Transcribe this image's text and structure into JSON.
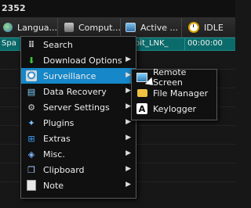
{
  "title": "2352",
  "header": {
    "columns": [
      {
        "label": "Langua...",
        "icon": "globe-icon"
      },
      {
        "label": "Comput...",
        "icon": "computer-icon"
      },
      {
        "label": "Active ...",
        "icon": "monitor-icon"
      },
      {
        "label": "IDLE",
        "icon": "clock-icon"
      }
    ]
  },
  "selected_row": {
    "c1": "Spa",
    "c2": "ploit_LNK_",
    "c3": "00:00:00"
  },
  "context_menu": {
    "items": [
      {
        "label": "Search",
        "icon": "search-icon",
        "submenu": false
      },
      {
        "label": "Download Options",
        "icon": "download-icon",
        "submenu": true
      },
      {
        "label": "Surveillance",
        "icon": "surveillance-icon",
        "submenu": true,
        "highlighted": true
      },
      {
        "label": "Data Recovery",
        "icon": "data-recovery-icon",
        "submenu": true
      },
      {
        "label": "Server Settings",
        "icon": "gear-icon",
        "submenu": true
      },
      {
        "label": "Plugins",
        "icon": "plugins-icon",
        "submenu": true
      },
      {
        "label": "Extras",
        "icon": "extras-icon",
        "submenu": true
      },
      {
        "label": "Misc.",
        "icon": "misc-icon",
        "submenu": true
      },
      {
        "label": "Clipboard",
        "icon": "clipboard-icon",
        "submenu": true
      },
      {
        "label": "Note",
        "icon": "note-icon",
        "submenu": true
      }
    ]
  },
  "submenu": {
    "items": [
      {
        "label": "Remote Screen",
        "icon": "remote-screen-icon"
      },
      {
        "label": "File Manager",
        "icon": "folder-icon"
      },
      {
        "label": "Keylogger",
        "icon": "keylogger-icon"
      }
    ]
  },
  "colors": {
    "highlight": "#1687c8",
    "selected_row": "#0b6b6b",
    "background": "#171717"
  }
}
